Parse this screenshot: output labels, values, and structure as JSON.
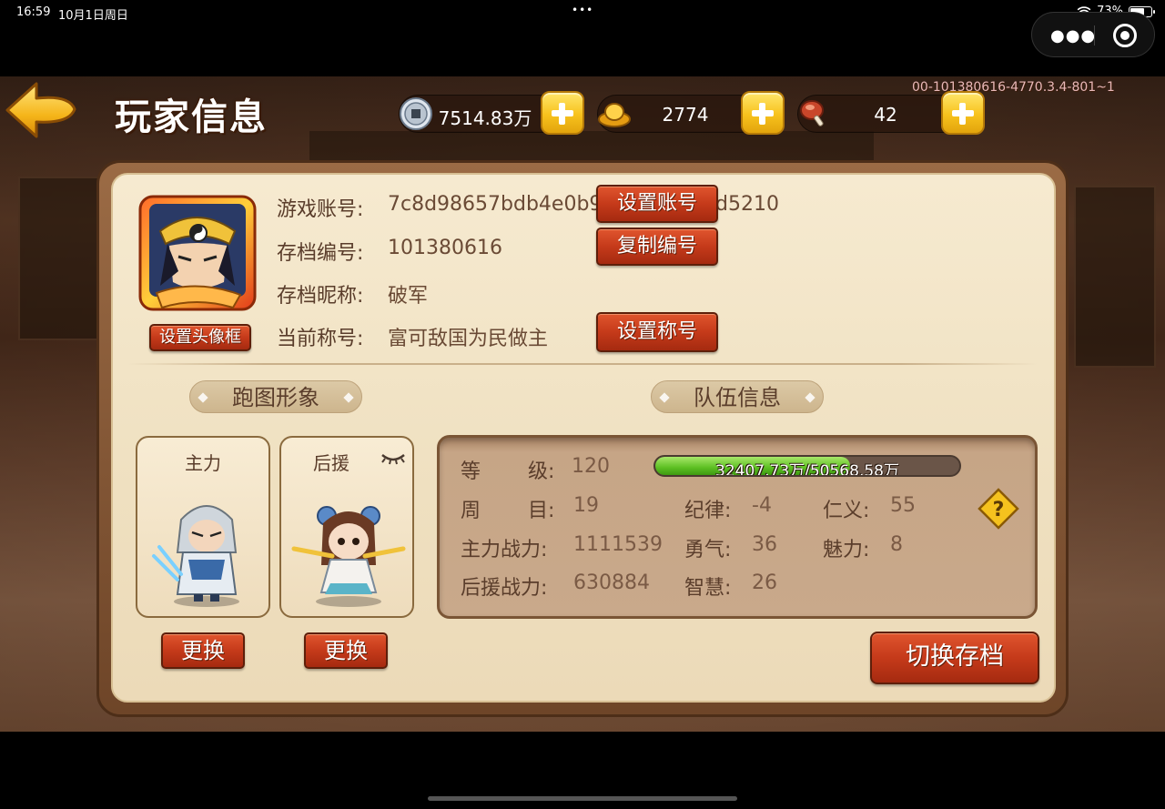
{
  "status_bar": {
    "time": "16:59",
    "date": "10月1日周日",
    "dots": "•••",
    "battery_percent": "73%",
    "battery_level": 0.73
  },
  "capsule": {
    "more_icon": "more-dots-icon",
    "close_icon": "target-circle-icon"
  },
  "header": {
    "title": "玩家信息",
    "version": "00-101380616-4770.3.4-801~1",
    "resources": [
      {
        "name": "copper-coin",
        "value": "7514.83万"
      },
      {
        "name": "gold-ingot",
        "value": "2774"
      },
      {
        "name": "meat-stamina",
        "value": "42"
      }
    ]
  },
  "profile": {
    "account_label": "游戏账号:",
    "account_value": "7c8d98657bdb4e0b9",
    "account_value_tail": "d5210",
    "set_account_btn": "设置账号",
    "save_id_label": "存档编号:",
    "save_id_value": "101380616",
    "copy_id_btn": "复制编号",
    "nickname_label": "存档昵称:",
    "nickname_value": "破军",
    "title_label": "当前称号:",
    "title_value": "富可敌国为民做主",
    "set_title_btn": "设置称号",
    "set_avatar_frame_btn": "设置头像框"
  },
  "map_image": {
    "heading": "跑图形象",
    "main_label": "主力",
    "support_label": "后援",
    "change_btn": "更换"
  },
  "team": {
    "heading": "队伍信息",
    "level_label_1": "等",
    "level_label_2": "级:",
    "level_value": "120",
    "xp_text": "32407.73万/50568.58万",
    "xp_fraction": 0.641,
    "round_label_1": "周",
    "round_label_2": "目:",
    "round_value": "19",
    "discipline_label": "纪律:",
    "discipline_value": "-4",
    "benevolence_label": "仁义:",
    "benevolence_value": "55",
    "main_power_label": "主力战力:",
    "main_power_value": "1111539",
    "courage_label": "勇气:",
    "courage_value": "36",
    "charm_label": "魅力:",
    "charm_value": "8",
    "support_power_label": "后援战力:",
    "support_power_value": "630884",
    "wisdom_label": "智慧:",
    "wisdom_value": "26",
    "help_icon": "question-mark-icon"
  },
  "switch_save_btn": "切换存档",
  "colors": {
    "accent_red": "#c53a1a",
    "panel_bg": "#f6ead0",
    "xp_green": "#5cbf22",
    "gold": "#f7c21d"
  }
}
